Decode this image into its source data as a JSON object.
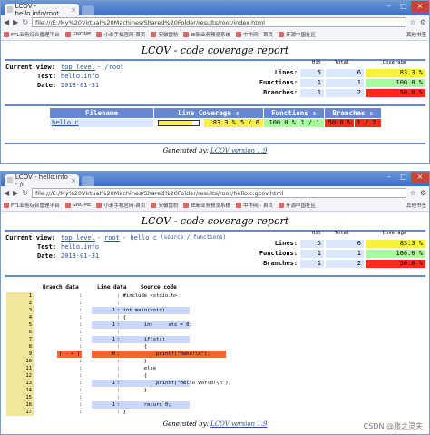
{
  "w1": {
    "tab": "LCOV - hello.info/root",
    "url": "file:///E:/My%20Virtual%20Machines/Shared%20Folder/results/root/index.html"
  },
  "w2": {
    "tab": "LCOV - hello.info - /r",
    "url": "file:///E:/My%20Virtual%20Machines/Shared%20Folder/results/root/hello.c.gcov.html"
  },
  "bookmarks": [
    "FTL业务综合管理平台",
    "GNOME",
    "小米手机官网-首页",
    "安徽雷豹",
    "IE新业务预览系统",
    "中华网 - 首页",
    "开源中国社区"
  ],
  "bookmarks_right": "其他书签",
  "page_title": "LCOV - code coverage report",
  "p1": {
    "current_view_label": "Current view:",
    "top_level": "top level",
    "path": "- /root",
    "test_label": "Test:",
    "test": "hello.info",
    "date_label": "Date:",
    "date": "2013-01-31"
  },
  "p2": {
    "current_view_label": "Current view:",
    "top_level": "top level",
    "sep": "-",
    "root": "root",
    "file": "- hello.c",
    "source_link": "(source / functions)",
    "test_label": "Test:",
    "test": "hello.info",
    "date_label": "Date:",
    "date": "2013-01-31"
  },
  "summary": {
    "col_hit": "Hit",
    "col_total": "Total",
    "col_cov": "Coverage",
    "rows": [
      {
        "label": "Lines:",
        "hit": "5",
        "total": "6",
        "cov": "83.3 %"
      },
      {
        "label": "Functions:",
        "hit": "1",
        "total": "1",
        "cov": "100.0 %"
      },
      {
        "label": "Branches:",
        "hit": "1",
        "total": "2",
        "cov": "50.0 %"
      }
    ]
  },
  "ftable": {
    "h_file": "Filename",
    "h_line": "Line Coverage ⇕",
    "h_func": "Functions ⇕",
    "h_branch": "Branches ⇕",
    "file": "hello.c",
    "line_pct": "83.3 %",
    "line_ratio": "5 / 6",
    "line_fill": 0.833,
    "func_pct": "100.0 %",
    "func_ratio": "1 / 1",
    "br_pct": "50.0 %",
    "br_ratio": "1 / 2"
  },
  "footer_text": "Generated by:",
  "footer_link": "LCOV version 1.9",
  "src_head": {
    "branch": "Branch data",
    "line": "Line data",
    "code": "Source code"
  },
  "src": [
    {
      "n": "1",
      "b": "",
      "c": "",
      "code": ": #include <stdio.h>"
    },
    {
      "n": "2",
      "b": "",
      "c": "",
      "code": ":"
    },
    {
      "n": "3",
      "b": "",
      "c": "1",
      "code": ": int main(void)"
    },
    {
      "n": "4",
      "b": "",
      "c": "",
      "code": ": {"
    },
    {
      "n": "5",
      "b": "",
      "c": "1",
      "code": ":        int     sts = 0;"
    },
    {
      "n": "6",
      "b": "",
      "c": "",
      "code": ":"
    },
    {
      "n": "7",
      "b": "",
      "c": "1",
      "code": ":        if(sts)"
    },
    {
      "n": "8",
      "b": "",
      "c": "",
      "code": ":        {"
    },
    {
      "n": "9",
      "b": "[ - + ]",
      "c": "0",
      "code": ":            printf(\"Haha!\\n\");"
    },
    {
      "n": "10",
      "b": "",
      "c": "",
      "code": ":        }"
    },
    {
      "n": "11",
      "b": "",
      "c": "",
      "code": ":        else"
    },
    {
      "n": "12",
      "b": "",
      "c": "",
      "code": ":        {"
    },
    {
      "n": "13",
      "b": "",
      "c": "1",
      "code": ":            printf(\"Hello world!\\n\");"
    },
    {
      "n": "14",
      "b": "",
      "c": "",
      "code": ":        }"
    },
    {
      "n": "15",
      "b": "",
      "c": "",
      "code": ":"
    },
    {
      "n": "16",
      "b": "",
      "c": "1",
      "code": ":        return 0;"
    },
    {
      "n": "17",
      "b": "",
      "c": "",
      "code": ": }"
    }
  ],
  "watermark": "CSDN @旅之灵夫"
}
